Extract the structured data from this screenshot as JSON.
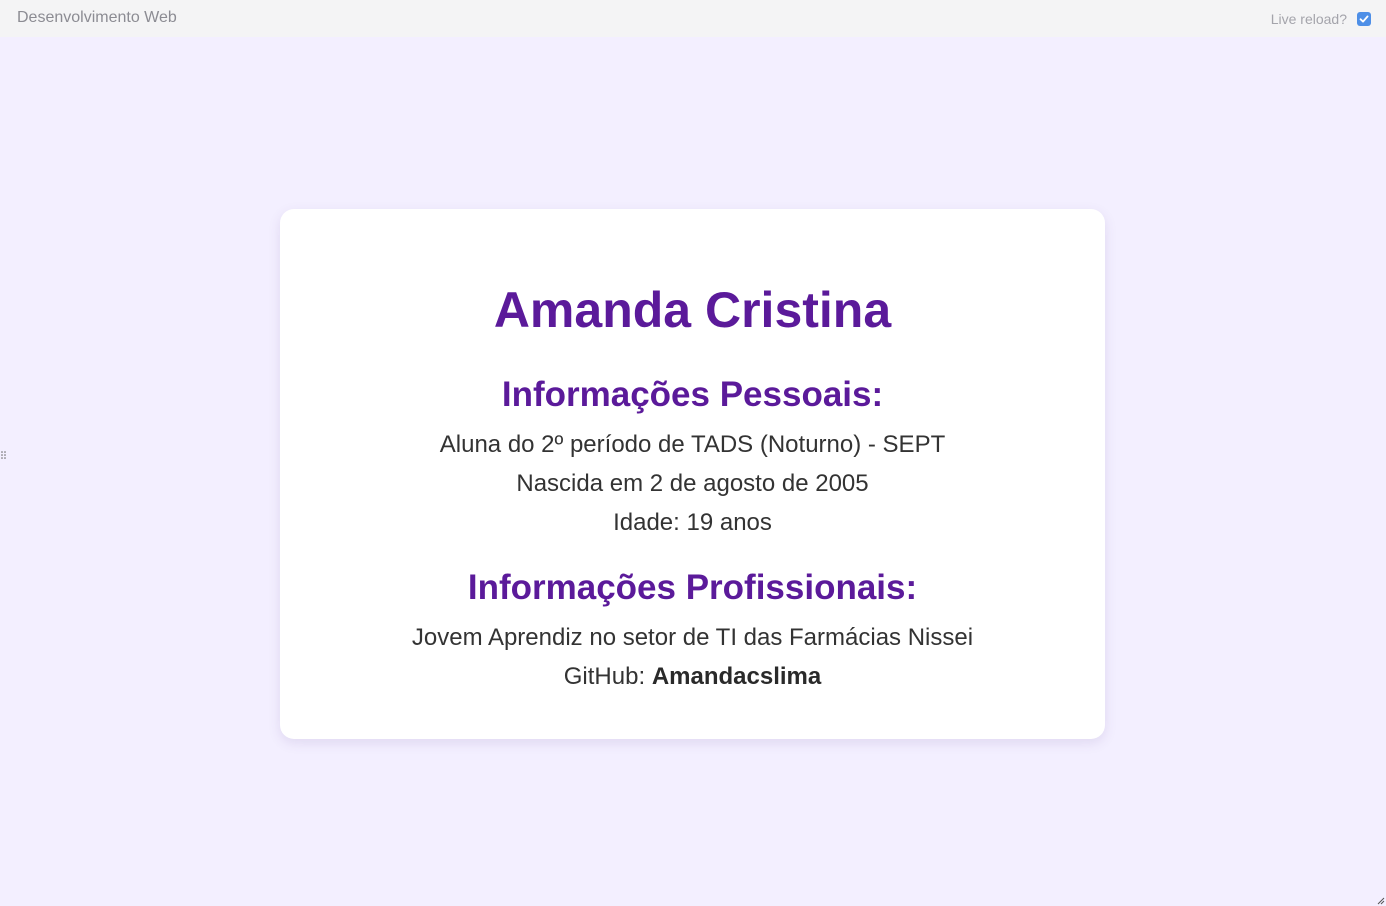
{
  "topbar": {
    "title": "Desenvolvimento Web",
    "live_reload_label": "Live reload?",
    "live_reload_checked": true
  },
  "profile": {
    "name": "Amanda Cristina",
    "personal": {
      "heading": "Informações Pessoais:",
      "lines": [
        "Aluna do 2º período de TADS (Noturno) - SEPT",
        "Nascida em 2 de agosto de 2005",
        "Idade: 19 anos"
      ]
    },
    "professional": {
      "heading": "Informações Profissionais:",
      "job": "Jovem Aprendiz no setor de TI das Farmácias Nissei",
      "github_label": "GitHub:",
      "github_user": "Amandacslima"
    }
  },
  "colors": {
    "page_background": "#f3efff",
    "accent": "#5b1a9a",
    "checkbox": "#4e8fe7"
  },
  "icons": {
    "drag_handle": "drag-handle-icon",
    "resize": "resize-corner-icon",
    "checkmark": "checkmark-icon"
  }
}
